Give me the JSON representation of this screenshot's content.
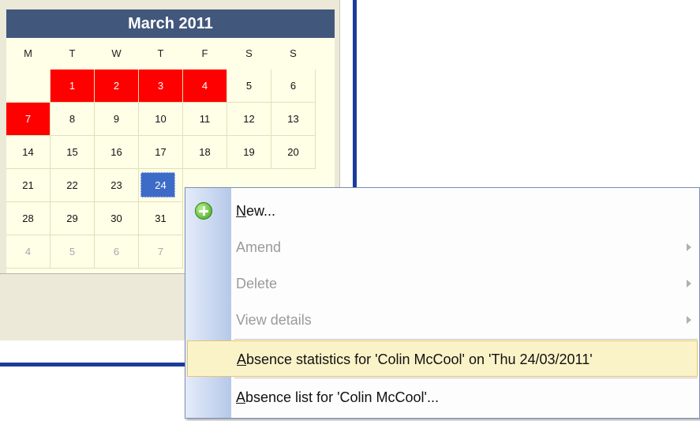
{
  "calendar": {
    "month_title": "March 2011",
    "weekdays": [
      "M",
      "T",
      "W",
      "T",
      "F",
      "S",
      "S"
    ],
    "weeks": [
      [
        {
          "label": "",
          "state": "normal"
        },
        {
          "label": "1",
          "state": "absent"
        },
        {
          "label": "2",
          "state": "absent"
        },
        {
          "label": "3",
          "state": "absent"
        },
        {
          "label": "4",
          "state": "absent"
        },
        {
          "label": "5",
          "state": "normal"
        },
        {
          "label": "6",
          "state": "normal"
        }
      ],
      [
        {
          "label": "7",
          "state": "absent"
        },
        {
          "label": "8",
          "state": "normal"
        },
        {
          "label": "9",
          "state": "normal"
        },
        {
          "label": "10",
          "state": "normal"
        },
        {
          "label": "11",
          "state": "normal"
        },
        {
          "label": "12",
          "state": "normal"
        },
        {
          "label": "13",
          "state": "normal"
        }
      ],
      [
        {
          "label": "14",
          "state": "normal"
        },
        {
          "label": "15",
          "state": "normal"
        },
        {
          "label": "16",
          "state": "normal"
        },
        {
          "label": "17",
          "state": "normal"
        },
        {
          "label": "18",
          "state": "normal"
        },
        {
          "label": "19",
          "state": "normal"
        },
        {
          "label": "20",
          "state": "normal"
        }
      ],
      [
        {
          "label": "21",
          "state": "normal"
        },
        {
          "label": "22",
          "state": "normal"
        },
        {
          "label": "23",
          "state": "normal"
        },
        {
          "label": "24",
          "state": "selected"
        }
      ],
      [
        {
          "label": "28",
          "state": "normal"
        },
        {
          "label": "29",
          "state": "normal"
        },
        {
          "label": "30",
          "state": "normal"
        },
        {
          "label": "31",
          "state": "normal"
        }
      ],
      [
        {
          "label": "4",
          "state": "other"
        },
        {
          "label": "5",
          "state": "other"
        },
        {
          "label": "6",
          "state": "other"
        },
        {
          "label": "7",
          "state": "other"
        }
      ]
    ]
  },
  "context_menu": {
    "items": [
      {
        "key": "N",
        "rest": "ew...",
        "enabled": true,
        "has_submenu": false,
        "icon": "add-icon"
      },
      {
        "label": "Amend",
        "enabled": false,
        "has_submenu": true
      },
      {
        "label": "Delete",
        "enabled": false,
        "has_submenu": true
      },
      {
        "label": "View details",
        "enabled": false,
        "has_submenu": true
      },
      {
        "key": "A",
        "rest": "bsence statistics for 'Colin McCool' on 'Thu 24/03/2011'",
        "enabled": true,
        "has_submenu": false,
        "highlighted": true
      },
      {
        "key": "A",
        "rest": "bsence list for 'Colin McCool'...",
        "enabled": true,
        "has_submenu": false
      }
    ]
  },
  "colors": {
    "header_bg": "#42577c",
    "absence_red": "#ff0000",
    "selected_blue": "#3d6bc8",
    "calendar_bg": "#ffffe7",
    "highlight_bg": "#fbf3c8"
  }
}
